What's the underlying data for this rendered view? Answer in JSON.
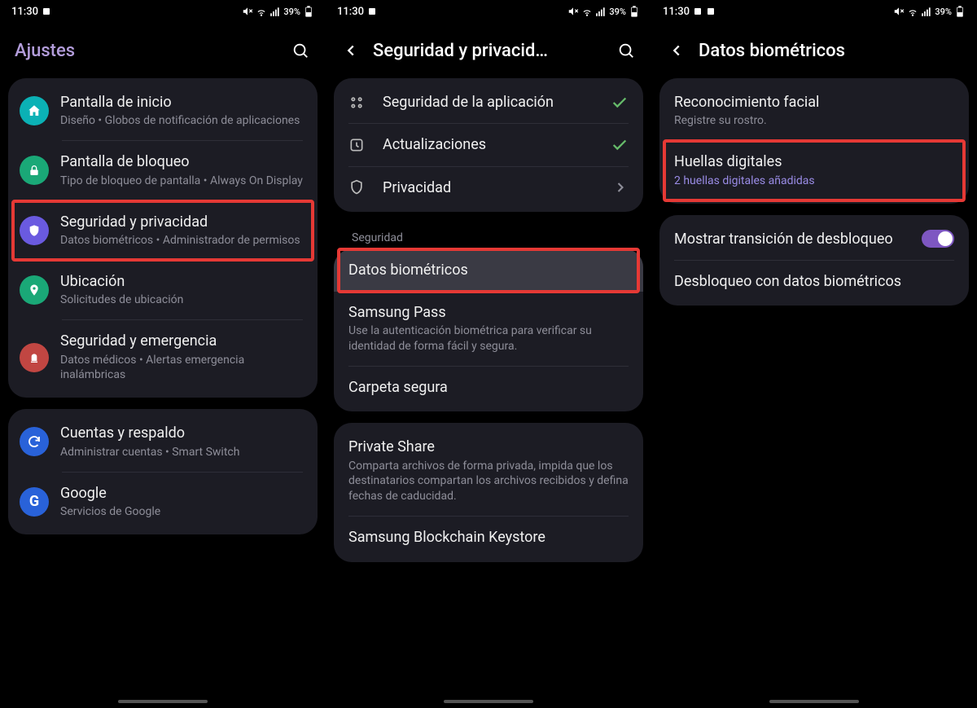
{
  "status": {
    "time": "11:30",
    "battery": "39%"
  },
  "screen1": {
    "title": "Ajustes",
    "items": [
      {
        "title": "Pantalla de inicio",
        "sub": "Diseño  •  Globos de notificación de aplicaciones",
        "iconColor": "#0bb1b5",
        "iconName": "home-icon"
      },
      {
        "title": "Pantalla de bloqueo",
        "sub": "Tipo de bloqueo de pantalla  •  Always On Display",
        "iconColor": "#1aa877",
        "iconName": "lock-icon"
      },
      {
        "title": "Seguridad y privacidad",
        "sub": "Datos biométricos  •  Administrador de permisos",
        "iconColor": "#6a5ae0",
        "iconName": "shield-icon",
        "highlight": true
      },
      {
        "title": "Ubicación",
        "sub": "Solicitudes de ubicación",
        "iconColor": "#1aa877",
        "iconName": "location-icon"
      },
      {
        "title": "Seguridad y emergencia",
        "sub": "Datos médicos  •  Alertas emergencia inalámbricas",
        "iconColor": "#c14642",
        "iconName": "emergency-icon"
      }
    ],
    "items2": [
      {
        "title": "Cuentas y respaldo",
        "sub": "Administrar cuentas  •  Smart Switch",
        "iconColor": "#2962d9",
        "iconName": "sync-icon"
      },
      {
        "title": "Google",
        "sub": "Servicios de Google",
        "iconColor": "#2962d9",
        "iconName": "google-icon"
      }
    ]
  },
  "screen2": {
    "title": "Seguridad y privacid…",
    "topItems": [
      {
        "title": "Seguridad de la aplicación",
        "iconName": "apps-icon",
        "status": "check"
      },
      {
        "title": "Actualizaciones",
        "iconName": "update-icon",
        "status": "check"
      },
      {
        "title": "Privacidad",
        "iconName": "privacy-icon",
        "status": "chevron"
      }
    ],
    "sectionLabel": "Seguridad",
    "secItems": [
      {
        "title": "Datos biométricos",
        "highlight": true,
        "selected": true
      },
      {
        "title": "Samsung Pass",
        "sub": "Use la autenticación biométrica para verificar su identidad de forma fácil y segura."
      },
      {
        "title": "Carpeta segura"
      }
    ],
    "secItems2": [
      {
        "title": "Private Share",
        "sub": "Comparta archivos de forma privada, impida que los destinatarios compartan los archivos recibidos y defina fechas de caducidad."
      },
      {
        "title": "Samsung Blockchain Keystore"
      }
    ]
  },
  "screen3": {
    "title": "Datos biométricos",
    "items": [
      {
        "title": "Reconocimiento facial",
        "sub": "Registre su rostro."
      },
      {
        "title": "Huellas digitales",
        "sub": "2 huellas digitales añadidas",
        "highlight": true,
        "subAccent": true
      }
    ],
    "items2": [
      {
        "title": "Mostrar transición de desbloqueo",
        "toggle": true
      },
      {
        "title": "Desbloqueo con datos biométricos"
      }
    ]
  }
}
